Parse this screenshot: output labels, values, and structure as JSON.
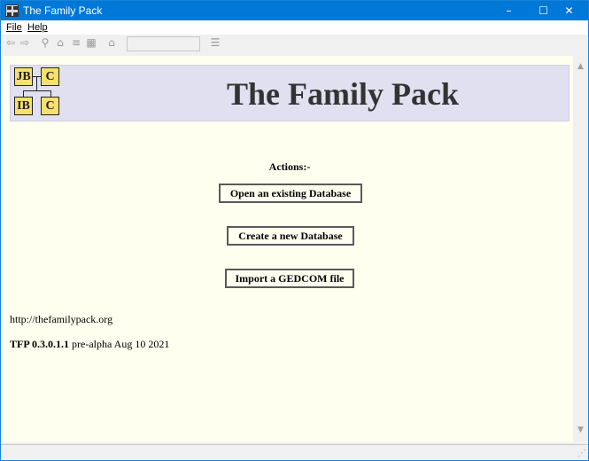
{
  "window": {
    "title": "The Family Pack",
    "controls": {
      "minimize": "–",
      "maximize": "☐",
      "close": "✕"
    }
  },
  "menu": {
    "items": [
      {
        "label": "File"
      },
      {
        "label": "Help"
      }
    ]
  },
  "toolbar": {
    "buttons": [
      {
        "icon": "back-arrow-icon",
        "glyph": "⇦"
      },
      {
        "icon": "forward-arrow-icon",
        "glyph": "⇨"
      },
      {
        "icon": "search-icon",
        "glyph": "⚲"
      },
      {
        "icon": "home-icon",
        "glyph": "⌂"
      },
      {
        "icon": "document-icon",
        "glyph": "≡"
      },
      {
        "icon": "film-icon",
        "glyph": "▦"
      },
      {
        "icon": "house-icon",
        "glyph": "⌂"
      },
      {
        "icon": "list-icon",
        "glyph": "☰"
      }
    ],
    "search_value": ""
  },
  "page": {
    "title": "The Family Pack",
    "logo_letters": [
      "JB",
      "C",
      "IB",
      "C"
    ],
    "actions_heading": "Actions:-",
    "actions": [
      {
        "label": "Open an existing Database"
      },
      {
        "label": "Create a new Database"
      },
      {
        "label": "Import a GEDCOM file"
      }
    ],
    "url": "http://thefamilypack.org",
    "version_bold": "TFP 0.3.0.1.1",
    "version_rest": " pre-alpha Aug 10 2021"
  },
  "scrollbar": {
    "up": "▲",
    "down": "▼"
  },
  "colors": {
    "titlebar": "#0078d7",
    "content_background": "#fffff0",
    "banner_background": "#e0e0f0",
    "title_text": "#333333"
  }
}
